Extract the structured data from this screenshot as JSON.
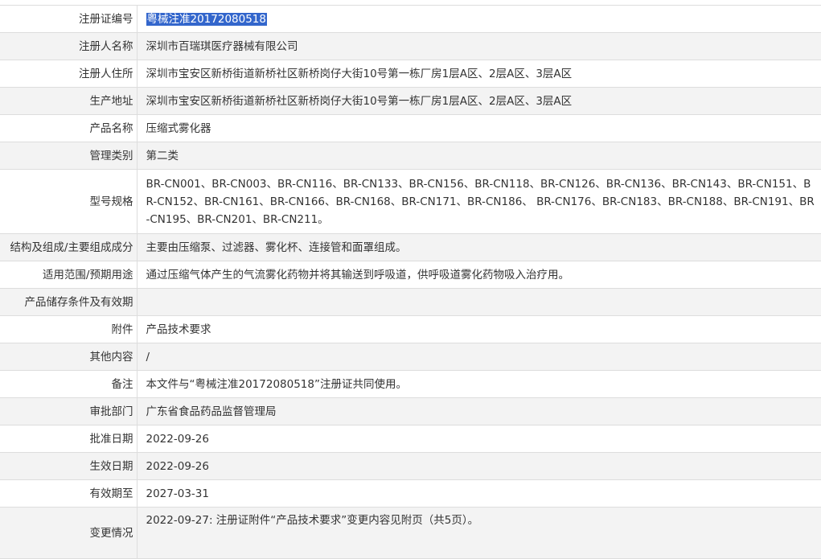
{
  "rows": [
    {
      "label": "注册证编号",
      "value": "粤械注准20172080518"
    },
    {
      "label": "注册人名称",
      "value": "深圳市百瑞琪医疗器械有限公司"
    },
    {
      "label": "注册人住所",
      "value": "深圳市宝安区新桥街道新桥社区新桥岗仔大街10号第一栋厂房1层A区、2层A区、3层A区"
    },
    {
      "label": "生产地址",
      "value": "深圳市宝安区新桥街道新桥社区新桥岗仔大街10号第一栋厂房1层A区、2层A区、3层A区"
    },
    {
      "label": "产品名称",
      "value": "压缩式雾化器"
    },
    {
      "label": "管理类别",
      "value": "第二类"
    },
    {
      "label": "型号规格",
      "value": "BR-CN001、BR-CN003、BR-CN116、BR-CN133、BR-CN156、BR-CN118、BR-CN126、BR-CN136、BR-CN143、BR-CN151、BR-CN152、BR-CN161、BR-CN166、BR-CN168、BR-CN171、BR-CN186、 BR-CN176、BR-CN183、BR-CN188、BR-CN191、BR-CN195、BR-CN201、BR-CN211。"
    },
    {
      "label": "结构及组成/主要组成成分",
      "value": "主要由压缩泵、过滤器、雾化杯、连接管和面罩组成。"
    },
    {
      "label": "适用范围/预期用途",
      "value": "通过压缩气体产生的气流雾化药物并将其输送到呼吸道，供呼吸道雾化药物吸入治疗用。"
    },
    {
      "label": "产品储存条件及有效期",
      "value": ""
    },
    {
      "label": "附件",
      "value": "产品技术要求"
    },
    {
      "label": "其他内容",
      "value": "/"
    },
    {
      "label": "备注",
      "value": "本文件与“粤械注准20172080518”注册证共同使用。"
    },
    {
      "label": "审批部门",
      "value": "广东省食品药品监督管理局"
    },
    {
      "label": "批准日期",
      "value": "2022-09-26"
    },
    {
      "label": "生效日期",
      "value": "2022-09-26"
    },
    {
      "label": "有效期至",
      "value": "2027-03-31"
    },
    {
      "label": "变更情况",
      "value": "2022-09-27: 注册证附件“产品技术要求”变更内容见附页（共5页）。"
    }
  ],
  "selection": {
    "selected_row": "注册证编号",
    "highlight_color": "#3366cc"
  }
}
